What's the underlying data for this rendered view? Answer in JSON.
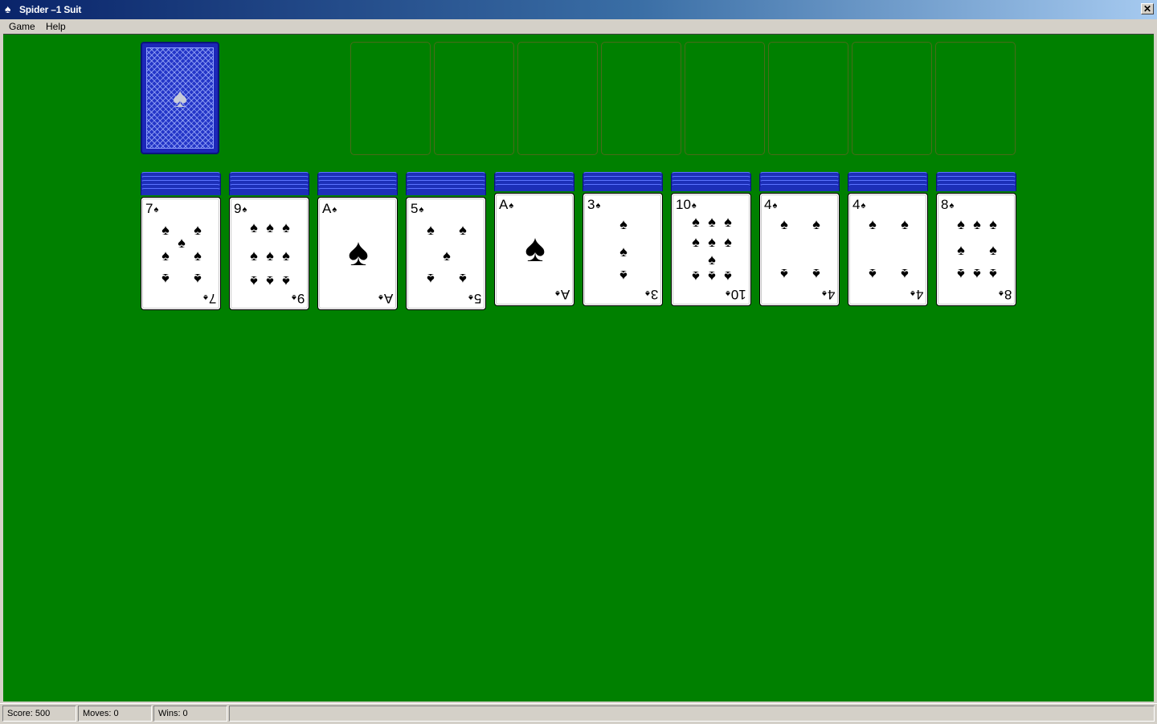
{
  "window": {
    "title": "Spider –1 Suit",
    "title_icon": "spade-icon",
    "close_glyph": "✕"
  },
  "menu": [
    "Game",
    "Help"
  ],
  "stock": {
    "glyph": "♠"
  },
  "foundation_count": 8,
  "tableau": [
    {
      "hidden": 5,
      "rank": "7",
      "suit": "♠"
    },
    {
      "hidden": 5,
      "rank": "9",
      "suit": "♠"
    },
    {
      "hidden": 5,
      "rank": "A",
      "suit": "♠"
    },
    {
      "hidden": 5,
      "rank": "5",
      "suit": "♠"
    },
    {
      "hidden": 4,
      "rank": "A",
      "suit": "♠"
    },
    {
      "hidden": 4,
      "rank": "3",
      "suit": "♠"
    },
    {
      "hidden": 4,
      "rank": "10",
      "suit": "♠"
    },
    {
      "hidden": 4,
      "rank": "4",
      "suit": "♠"
    },
    {
      "hidden": 4,
      "rank": "4",
      "suit": "♠"
    },
    {
      "hidden": 4,
      "rank": "8",
      "suit": "♠"
    }
  ],
  "status": {
    "score": "Score: 500",
    "moves": "Moves: 0",
    "wins": "Wins: 0"
  },
  "colors": {
    "felt": "#008000",
    "card_back": "#1c2fb8",
    "titlebar": "#0a246a"
  }
}
